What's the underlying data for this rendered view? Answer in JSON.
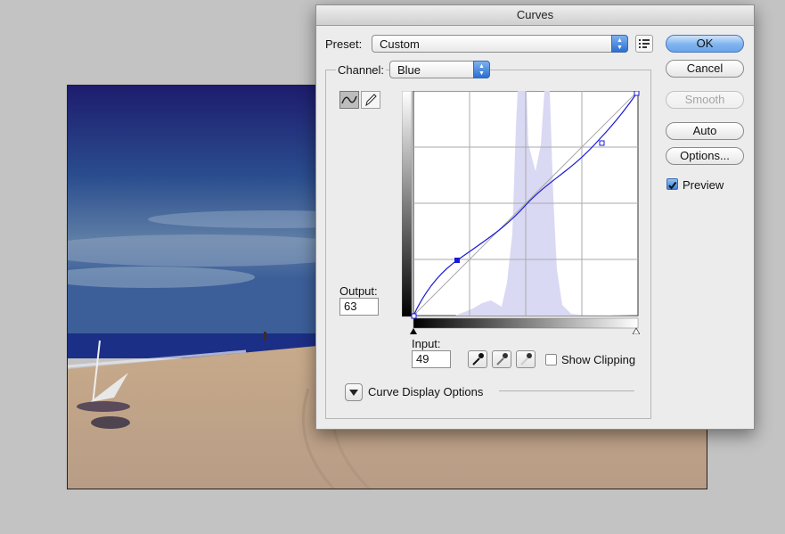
{
  "window": {
    "title": "Curves"
  },
  "preset": {
    "label": "Preset:",
    "value": "Custom"
  },
  "channel": {
    "label": "Channel:",
    "value": "Blue"
  },
  "buttons": {
    "ok": "OK",
    "cancel": "Cancel",
    "smooth": "Smooth",
    "auto": "Auto",
    "options": "Options..."
  },
  "preview": {
    "label": "Preview",
    "checked": true
  },
  "output": {
    "label": "Output:",
    "value": "63"
  },
  "input": {
    "label": "Input:",
    "value": "49"
  },
  "show_clipping": {
    "label": "Show Clipping",
    "checked": false
  },
  "curve_display_options": {
    "label": "Curve Display Options"
  },
  "curve": {
    "channel_color": "#1a1ad6",
    "points": [
      [
        0,
        0
      ],
      [
        49,
        63
      ],
      [
        207,
        191
      ],
      [
        255,
        255
      ]
    ],
    "histogram_color": "#d9d9f4"
  },
  "colors": {
    "accent": "#3d82d6",
    "dialog_bg": "#ececec"
  }
}
